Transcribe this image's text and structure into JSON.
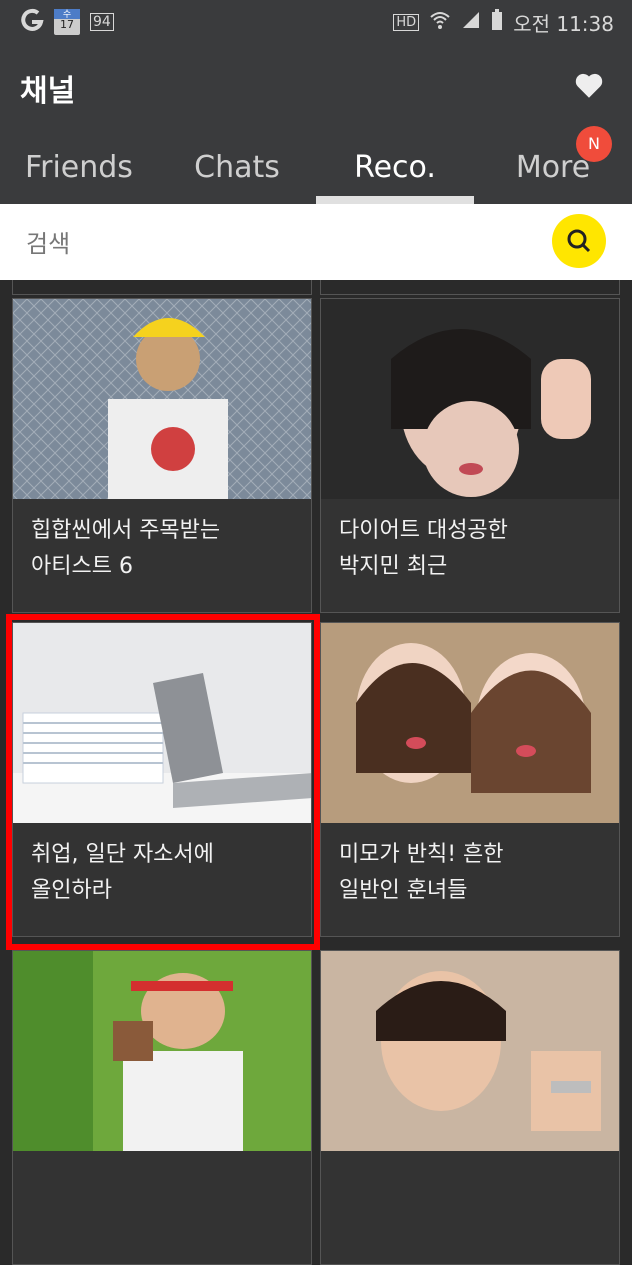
{
  "status_bar": {
    "left_icons": [
      "carrier-icon",
      "calendar-icon",
      "notification-icon"
    ],
    "calendar_day_label": "수",
    "calendar_date": "17",
    "notification_count": "94",
    "hd_label": "HD",
    "time": "오전 11:38"
  },
  "header": {
    "title": "채널",
    "tabs": [
      {
        "label": "Friends",
        "active": false
      },
      {
        "label": "Chats",
        "active": false
      },
      {
        "label": "Reco.",
        "active": true
      },
      {
        "label": "More",
        "active": false,
        "badge": "N"
      }
    ]
  },
  "search": {
    "placeholder": "검색"
  },
  "cards": [
    {
      "caption": "힙합씬에서 주목받는\n아티스트 6",
      "thumb_icon": "photo-rapper"
    },
    {
      "caption": "다이어트 대성공한\n박지민 최근",
      "thumb_icon": "photo-singer"
    },
    {
      "caption": "취업, 일단 자소서에\n올인하라",
      "thumb_icon": "photo-laptop-papers"
    },
    {
      "caption": "미모가 반칙! 흔한\n일반인 훈녀들",
      "thumb_icon": "photo-two-girls"
    },
    {
      "caption": "",
      "thumb_icon": "photo-shooter"
    },
    {
      "caption": "",
      "thumb_icon": "photo-actor"
    }
  ],
  "colors": {
    "accent_yellow": "#ffe600",
    "badge_red": "#f04c3b",
    "highlight_red": "#ff0000",
    "header_bg": "#3a3b3d"
  }
}
